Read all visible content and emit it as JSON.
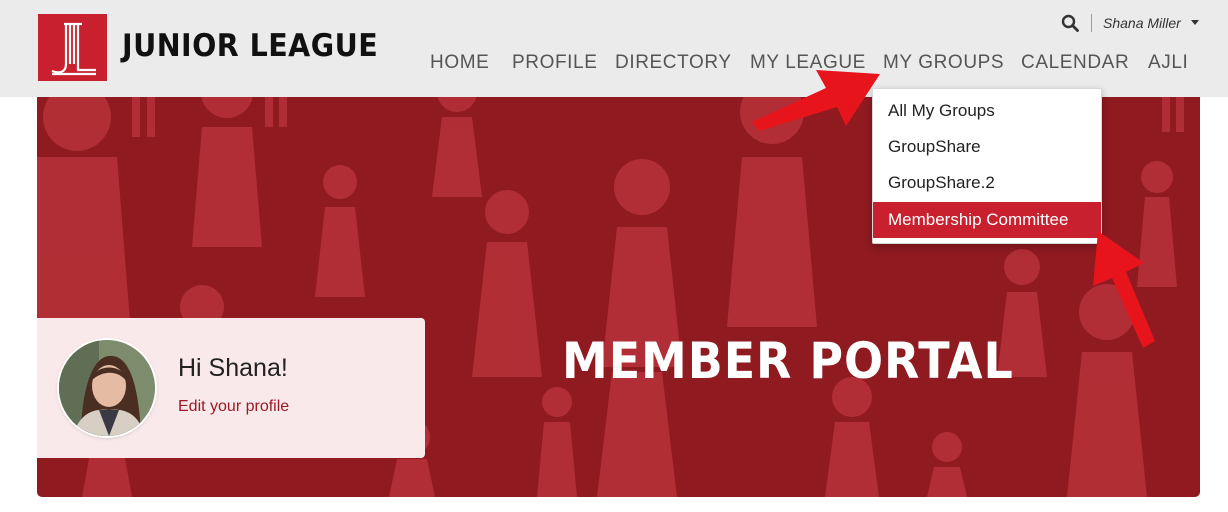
{
  "brand": {
    "name": "JUNIOR LEAGUE",
    "logo_icon": "junior-league-jl-logo"
  },
  "utility": {
    "search_icon": "search-icon",
    "user_name": "Shana Miller"
  },
  "nav": {
    "items": [
      {
        "label": "HOME"
      },
      {
        "label": "PROFILE"
      },
      {
        "label": "DIRECTORY"
      },
      {
        "label": "MY LEAGUE"
      },
      {
        "label": "MY GROUPS"
      },
      {
        "label": "CALENDAR"
      },
      {
        "label": "AJLI"
      }
    ]
  },
  "dropdown": {
    "items": [
      {
        "label": "All My Groups"
      },
      {
        "label": "GroupShare"
      },
      {
        "label": "GroupShare.2"
      },
      {
        "label": "Membership Committee"
      }
    ],
    "highlighted_index": 3
  },
  "hero": {
    "title": "MEMBER PORTAL"
  },
  "welcome": {
    "greeting": "Hi Shana!",
    "edit_link": "Edit your profile"
  },
  "colors": {
    "brand_red": "#c8202f",
    "hero_red": "#8f1a20",
    "figure_red": "#c43a3f",
    "arrow_red": "#e8141c",
    "topbar_gray": "#ebebeb",
    "link_red": "#9a1b24"
  }
}
